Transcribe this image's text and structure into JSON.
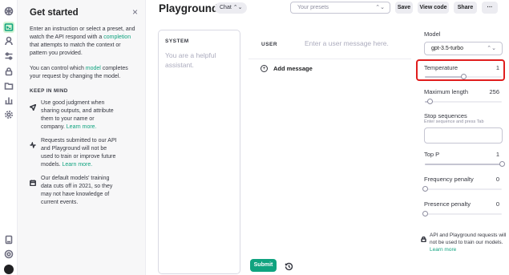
{
  "rail": {
    "icons": [
      "openai-logo-icon",
      "playground-icon",
      "assistant-icon",
      "tune-icon",
      "lock-icon",
      "folder-icon",
      "usage-chart-icon",
      "settings-gear-icon",
      "docs-icon",
      "help-icon",
      "user-avatar"
    ]
  },
  "get_started": {
    "title": "Get started",
    "close": "×",
    "intro_a": "Enter an instruction or select a preset, and watch the API respond with a ",
    "intro_link": "completion",
    "intro_b": " that attempts to match the context or pattern you provided.",
    "model_a": "You can control which ",
    "model_link": "model",
    "model_b": " completes your request by changing the model.",
    "keep_in_mind": "KEEP IN MIND",
    "tips": [
      {
        "icon": "send-icon",
        "text": "Use good judgment when sharing outputs, and attribute them to your name or company. ",
        "link": "Learn more."
      },
      {
        "icon": "activity-icon",
        "text": "Requests submitted to our API and Playground will not be used to train or improve future models. ",
        "link": "Learn more."
      },
      {
        "icon": "calendar-icon",
        "text": "Our default models' training data cuts off in 2021, so they may not have knowledge of current events.",
        "link": ""
      }
    ]
  },
  "topbar": {
    "title": "Playground",
    "mode": "Chat",
    "mode_chevron": "⌃⌄",
    "presets_placeholder": "Your presets",
    "presets_chevron": "⌃⌄",
    "save": "Save",
    "view_code": "View code",
    "share": "Share",
    "more": "···"
  },
  "system": {
    "label": "SYSTEM",
    "placeholder": "You are a helpful assistant."
  },
  "chat": {
    "user_label": "USER",
    "user_placeholder": "Enter a user message here.",
    "add_message": "Add message",
    "add_icon": "+",
    "submit": "Submit"
  },
  "settings": {
    "model_label": "Model",
    "model_value": "gpt-3.5-turbo",
    "model_chevron": "⌃⌄",
    "temperature_label": "Temperature",
    "temperature_value": "1",
    "temperature_fraction": 0.5,
    "max_length_label": "Maximum length",
    "max_length_value": "256",
    "max_length_fraction": 0.06,
    "stop_label": "Stop sequences",
    "stop_hint": "Enter sequence and press Tab",
    "top_p_label": "Top P",
    "top_p_value": "1",
    "top_p_fraction": 1.0,
    "freq_label": "Frequency penalty",
    "freq_value": "0",
    "freq_fraction": 0.0,
    "presence_label": "Presence penalty",
    "presence_value": "0",
    "presence_fraction": 0.0,
    "note_text": "API and Playground requests will not be used to train our models. ",
    "note_link": "Learn more",
    "highlight_color": "#e01d1d"
  },
  "colors": {
    "accent": "#10a37f",
    "highlight": "#e01d1d"
  }
}
